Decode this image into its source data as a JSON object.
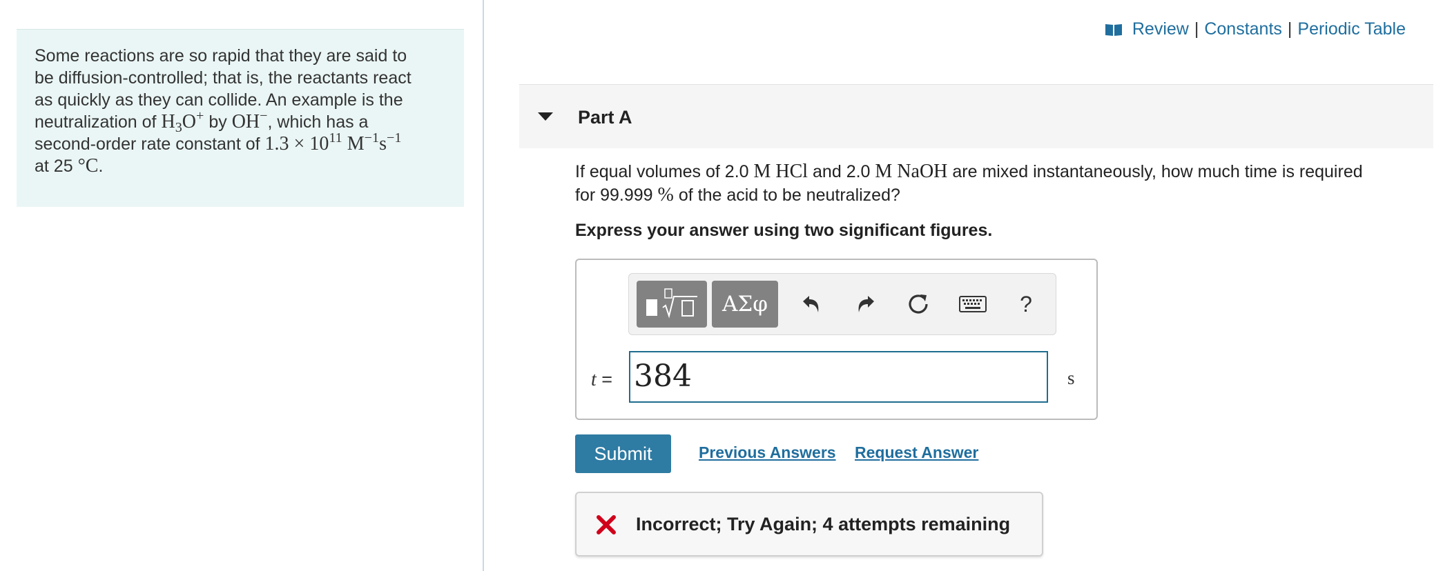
{
  "intro": {
    "line1": "Some reactions are so rapid that they are said to",
    "line2": "be diffusion-controlled; that is, the reactants react",
    "line3": "as quickly as they can collide. An example is the",
    "line4_pre": "neutralization of",
    "species1_base": "H",
    "species1_sub": "3",
    "species1_base2": "O",
    "species1_sup": "+",
    "by": "by",
    "species2_base": "OH",
    "species2_sup": "−",
    "line4_post": ", which has a",
    "line5_pre": "second-order rate constant of",
    "rate_coeff": "1.3 × 10",
    "rate_exp": "11",
    "rate_unit1": "M",
    "rate_unit1_exp": "−1",
    "rate_unit2": "s",
    "rate_unit2_exp": "−1",
    "line6_pre": "at 25",
    "temp_unit": "°C",
    "line6_post": "."
  },
  "resources": {
    "review": "Review",
    "constants": "Constants",
    "periodic_table": "Periodic Table",
    "separator": "|"
  },
  "part": {
    "title": "Part A"
  },
  "question": {
    "pre": "If equal volumes of 2.0",
    "m1": "M HCl",
    "mid": "and 2.0",
    "m2": "M NaOH",
    "post": "are mixed instantaneously, how much time is required",
    "line2_pre": "for 99.999",
    "percent": "%",
    "line2_post": "of the acid to be neutralized?",
    "instruction": "Express your answer using two significant figures."
  },
  "toolbar": {
    "symbols_label": "ΑΣφ",
    "help_label": "?"
  },
  "answer": {
    "variable": "t",
    "equals": "=",
    "value": "384",
    "unit": "s"
  },
  "actions": {
    "submit": "Submit",
    "previous_answers": "Previous Answers",
    "request_answer": "Request Answer"
  },
  "feedback": {
    "message": "Incorrect; Try Again; 4 attempts remaining"
  },
  "colors": {
    "link": "#1f6e9e",
    "submit_bg": "#2e7ba3",
    "intro_bg": "#eaf6f5",
    "error_icon": "#d0021b",
    "input_border": "#1e6d8f"
  }
}
